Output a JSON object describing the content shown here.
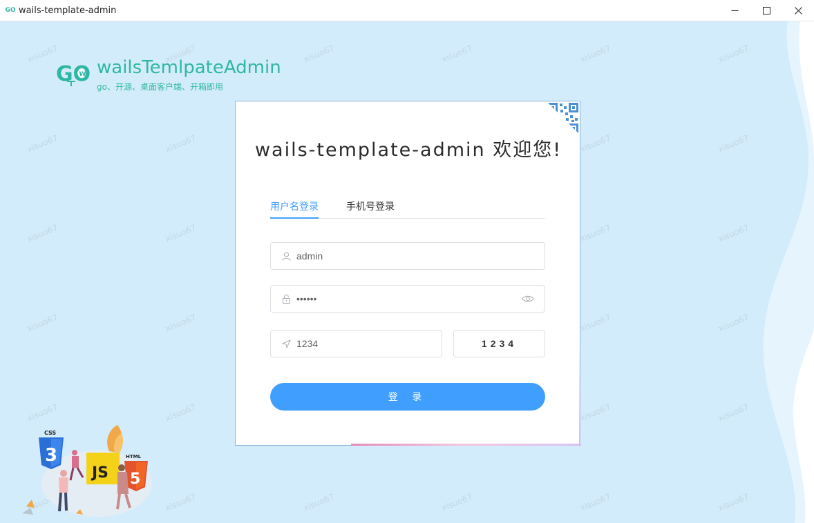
{
  "window": {
    "title": "wails-template-admin",
    "icon_text": "GO"
  },
  "brand": {
    "name": "wailsTemlpateAdmin",
    "subtitle": "go、开源、桌面客户端、开箱即用"
  },
  "watermark": "xisuo67",
  "login": {
    "title": "wails-template-admin 欢迎您!",
    "tabs": [
      {
        "label": "用户名登录",
        "active": true
      },
      {
        "label": "手机号登录",
        "active": false
      }
    ],
    "username": {
      "value": "admin",
      "icon": "user-icon"
    },
    "password": {
      "value": "••••••",
      "icon": "lock-icon",
      "toggle_icon": "eye-icon"
    },
    "captcha_input": {
      "value": "1234",
      "icon": "navigation-icon"
    },
    "captcha_image_text": "1234",
    "submit_label": "登 录"
  },
  "illustration": {
    "badges": [
      "CSS",
      "JS",
      "HTML"
    ]
  },
  "colors": {
    "accent": "#409eff",
    "brand": "#2fb7a4",
    "background": "#d3ecfb"
  }
}
